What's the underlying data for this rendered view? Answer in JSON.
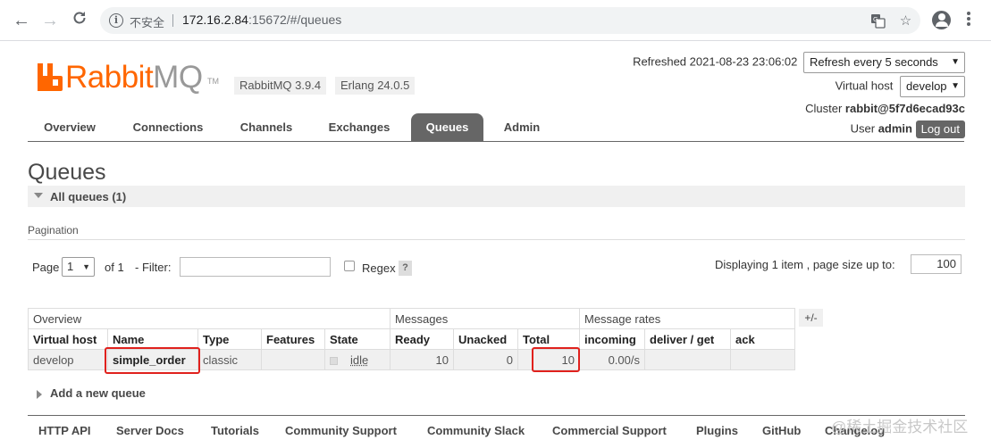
{
  "browser": {
    "insecure_label": "不安全",
    "url_host": "172.16.2.84",
    "url_rest": ":15672/#/queues"
  },
  "header": {
    "logo_rabbit": "Rabbit",
    "logo_mq": "MQ",
    "logo_tm": "TM",
    "rabbitmq_version": "RabbitMQ 3.9.4",
    "erlang_version": "Erlang 24.0.5",
    "refreshed_text": "Refreshed 2021-08-23 23:06:02",
    "refresh_select": "Refresh every 5 seconds",
    "virtual_host_label": "Virtual host",
    "virtual_host_value": "develop",
    "cluster_label": "Cluster",
    "cluster_value": "rabbit@5f7d6ecad93c",
    "user_label": "User",
    "user_value": "admin",
    "logout_label": "Log out"
  },
  "tabs": [
    {
      "label": "Overview"
    },
    {
      "label": "Connections"
    },
    {
      "label": "Channels"
    },
    {
      "label": "Exchanges"
    },
    {
      "label": "Queues",
      "active": true
    },
    {
      "label": "Admin"
    }
  ],
  "main": {
    "title": "Queues",
    "all_queues_label": "All queues (1)",
    "pagination_label": "Pagination",
    "page_label": "Page",
    "page_value": "1",
    "of_label": "of 1",
    "filter_label": "- Filter:",
    "filter_value": "",
    "regex_label": "Regex",
    "help_label": "?",
    "displaying_text": "Displaying 1 item , page size up to:",
    "page_size_value": "100"
  },
  "table": {
    "groups": [
      "Overview",
      "Messages",
      "Message rates"
    ],
    "plusminus_label": "+/-",
    "columns": [
      "Virtual host",
      "Name",
      "Type",
      "Features",
      "State",
      "Ready",
      "Unacked",
      "Total",
      "incoming",
      "deliver / get",
      "ack"
    ],
    "rows": [
      {
        "virtual_host": "develop",
        "name": "simple_order",
        "type": "classic",
        "features": "",
        "state": "idle",
        "ready": "10",
        "unacked": "0",
        "total": "10",
        "incoming": "0.00/s",
        "deliver_get": "",
        "ack": ""
      }
    ]
  },
  "add_queue_label": "Add a new queue",
  "footer": [
    "HTTP API",
    "Server Docs",
    "Tutorials",
    "Community Support",
    "Community Slack",
    "Commercial Support",
    "Plugins",
    "GitHub",
    "Changelog"
  ],
  "watermark": "@稀土掘金技术社区",
  "colors": {
    "brand": "#ff6600",
    "tab_active": "#666666",
    "highlight": "#e0211d"
  }
}
